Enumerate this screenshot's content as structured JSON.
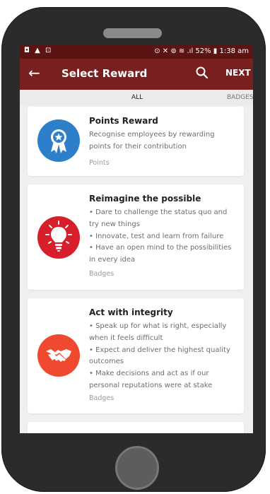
{
  "status": {
    "left_icons": "◘ ▲ ⊡",
    "right": "⊙ ✕ ⊚ ≋ .ıl 52% ▮ 1:38 am"
  },
  "appbar": {
    "back_glyph": "←",
    "title": "Select Reward",
    "next_label": "NEXT"
  },
  "tabs": [
    {
      "label": "ALL"
    },
    {
      "label": "BADGES"
    }
  ],
  "rewards": [
    {
      "title": "Points Reward",
      "lines": [
        "Recognise employees by rewarding",
        "points for their contribution"
      ],
      "category": "Points",
      "icon": "award-ribbon-icon",
      "color": "#2d7fc9"
    },
    {
      "title": "Reimagine the possible",
      "lines": [
        "• Dare to challenge the status quo and",
        "try new things",
        "• Innovate, test and learn from failure",
        "• Have an open mind to the possibilities",
        "in every idea"
      ],
      "category": "Badges",
      "icon": "lightbulb-icon",
      "color": "#d61f2b"
    },
    {
      "title": "Act with integrity",
      "lines": [
        "• Speak up for what is right, especially",
        "when it feels difficult",
        "• Expect and deliver the highest quality",
        "outcomes",
        "• Make decisions and act as if our",
        "personal reputations were at stake"
      ],
      "category": "Badges",
      "icon": "handshake-icon",
      "color": "#ef4a2f"
    }
  ]
}
